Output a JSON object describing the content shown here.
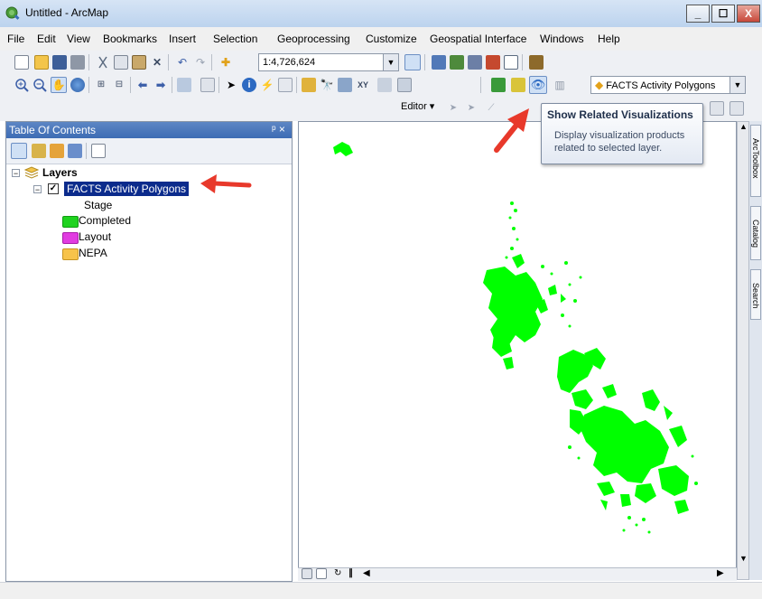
{
  "window": {
    "title": "Untitled - ArcMap",
    "controls": {
      "minimize": "_",
      "maximize": "☐",
      "close": "X"
    }
  },
  "menu": [
    "File",
    "Edit",
    "View",
    "Bookmarks",
    "Insert",
    "Selection",
    "Geoprocessing",
    "Customize",
    "Geospatial Interface",
    "Windows",
    "Help"
  ],
  "toolbar": {
    "scale": "1:4,726,624",
    "layer_dropdown": "FACTS Activity Polygons",
    "editor_label": "Editor"
  },
  "toc": {
    "title": "Table Of Contents",
    "pin_close": "ᵖ ×",
    "root": {
      "label": "Layers",
      "checked": true
    },
    "layer": {
      "label": "FACTS Activity Polygons",
      "checked": true,
      "field": "Stage"
    },
    "legend": [
      {
        "label": "Completed",
        "color": "#1fd31f"
      },
      {
        "label": "Layout",
        "color": "#e13ce1"
      },
      {
        "label": "NEPA",
        "color": "#f7c34a"
      }
    ]
  },
  "tooltip": {
    "title": "Show Related Visualizations",
    "body": "Display visualization products related to selected layer."
  },
  "dock_tabs": [
    "ArcToolbox",
    "Catalog",
    "Search"
  ],
  "map_colors": {
    "polygons": "#00ff00",
    "annotation_arrow": "#e8392b"
  }
}
